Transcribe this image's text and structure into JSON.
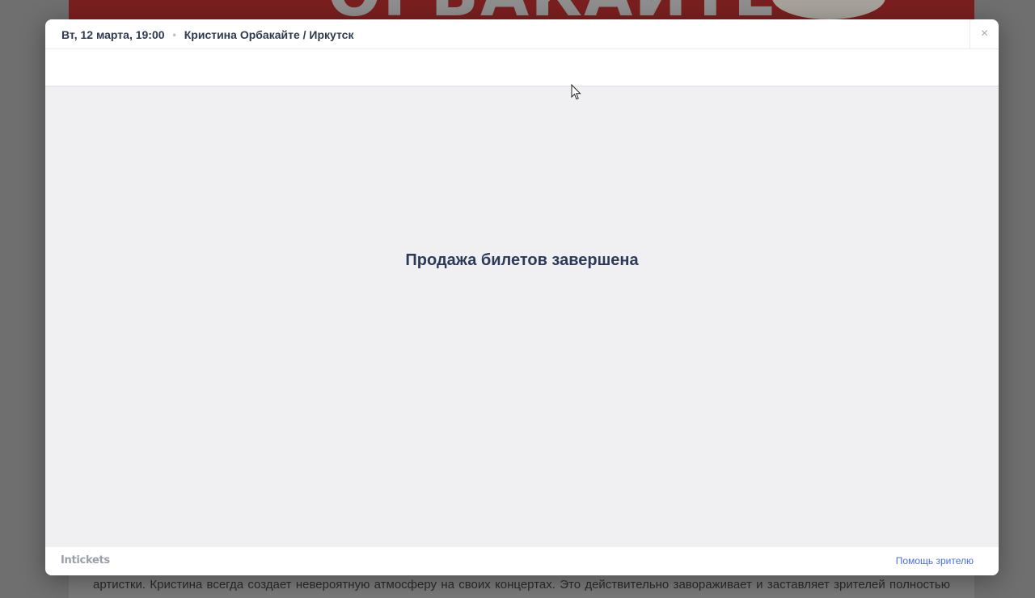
{
  "background": {
    "banner_text": "ОРБАКАЙТЕ",
    "paragraph": "артистки. Кристина всегда создает невероятную атмосферу на своих концертах. Это действительно завораживает и заставляет зрителей полностью"
  },
  "modal": {
    "header": {
      "date": "Вт, 12 марта, 19:00",
      "separator": "•",
      "event": "Кристина Орбакайте / Иркутск",
      "close_icon": "close-icon",
      "close_glyph": "×"
    },
    "body": {
      "message": "Продажа билетов завершена"
    },
    "footer": {
      "logo": "Intickets",
      "help_link": "Помощь зрителю"
    }
  },
  "colors": {
    "accent_link": "#4c6fd6",
    "title_text": "#2c3a57",
    "body_bg": "#f0f0f3"
  }
}
